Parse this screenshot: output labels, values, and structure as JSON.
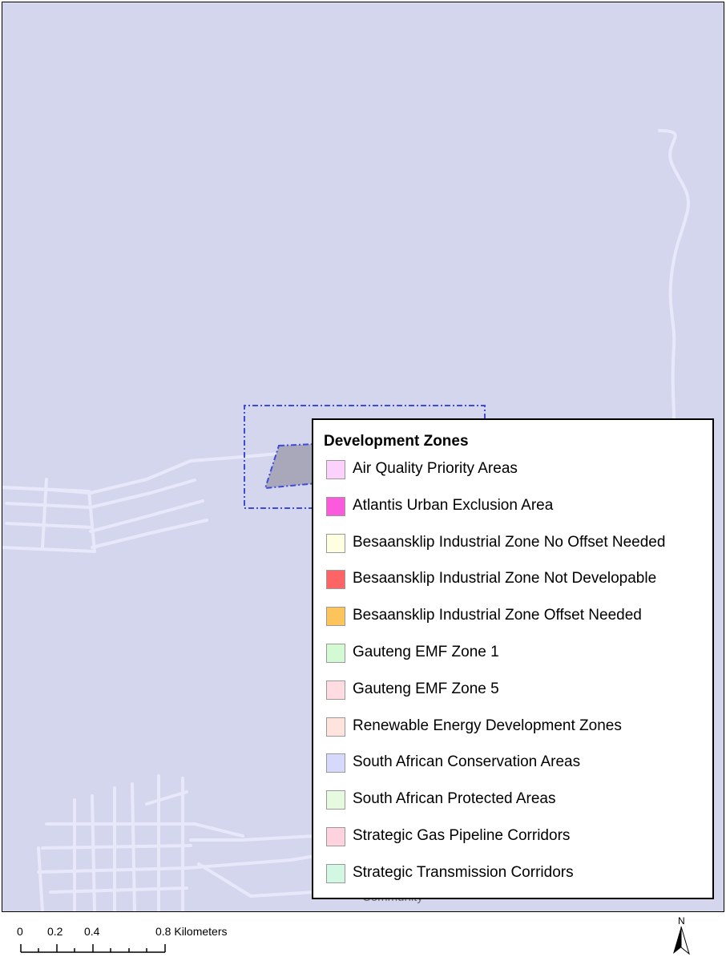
{
  "legend": {
    "title": "Development Zones",
    "items": [
      {
        "label": "Air Quality Priority Areas",
        "color": "#fcd2fc",
        "name": "legend-item-air-quality"
      },
      {
        "label": "Atlantis Urban Exclusion Area",
        "color": "#fc5adc",
        "name": "legend-item-atlantis"
      },
      {
        "label": "Besaansklip Industrial Zone No Offset Needed",
        "color": "#fefee0",
        "name": "legend-item-besaansklip-no-offset"
      },
      {
        "label": "Besaansklip Industrial Zone Not Developable",
        "color": "#fd6466",
        "name": "legend-item-besaansklip-not-developable"
      },
      {
        "label": "Besaansklip Industrial Zone Offset Needed",
        "color": "#fec45c",
        "name": "legend-item-besaansklip-offset"
      },
      {
        "label": "Gauteng EMF Zone 1",
        "color": "#d4fad4",
        "name": "legend-item-gauteng-zone-1"
      },
      {
        "label": "Gauteng EMF Zone 5",
        "color": "#fedce2",
        "name": "legend-item-gauteng-zone-5"
      },
      {
        "label": "Renewable Energy Development Zones",
        "color": "#fee4dc",
        "name": "legend-item-renewable"
      },
      {
        "label": "South African Conservation Areas",
        "color": "#d6d8fc",
        "name": "legend-item-conservation"
      },
      {
        "label": "South African Protected Areas",
        "color": "#e6fae0",
        "name": "legend-item-protected"
      },
      {
        "label": "Strategic Gas Pipeline Corridors",
        "color": "#fed2de",
        "name": "legend-item-gas-pipeline"
      },
      {
        "label": "Strategic Transmission Corridors",
        "color": "#d2f8e4",
        "name": "legend-item-transmission"
      }
    ]
  },
  "map": {
    "background_color": "#d4d6ee",
    "road_color": "#e6e6fa",
    "site_color": "#a8a8ba",
    "boundary_color": "#3e4bd8",
    "place_label": "Community"
  },
  "scale_bar": {
    "ticks": [
      "0",
      "0.2",
      "0.4",
      "0.8 Kilometers"
    ]
  },
  "north_arrow": {
    "label": "N"
  }
}
